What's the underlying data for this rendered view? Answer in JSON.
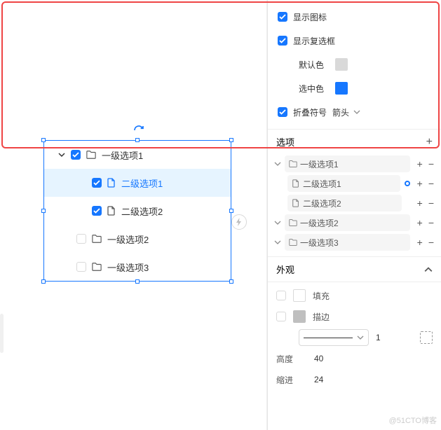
{
  "props": {
    "show_icon": "显示图标",
    "show_checkbox": "显示复选框",
    "default_color": "默认色",
    "selected_color": "选中色",
    "collapse_symbol": "折叠符号",
    "collapse_value": "箭头",
    "default_color_val": "#d9d9d9",
    "selected_color_val": "#1677ff"
  },
  "options": {
    "title": "选项",
    "items": [
      {
        "label": "一级选项1",
        "expand": true,
        "children": [
          {
            "label": "二级选项1",
            "active": true
          },
          {
            "label": "二级选项2"
          }
        ]
      },
      {
        "label": "一级选项2",
        "expand": true
      },
      {
        "label": "一级选项3",
        "expand": true
      }
    ]
  },
  "appearance": {
    "title": "外观",
    "fill": "填充",
    "stroke": "描边",
    "stroke_width": "1",
    "height_label": "高度",
    "height_val": "40",
    "indent_label": "缩进",
    "indent_val": "24"
  },
  "canvas": {
    "items": [
      {
        "label": "一级选项1",
        "checked": true,
        "type": "folder",
        "expanded": true,
        "level": 0
      },
      {
        "label": "二级选项1",
        "checked": true,
        "type": "file",
        "level": 1,
        "selected": true
      },
      {
        "label": "二级选项2",
        "checked": true,
        "type": "file",
        "level": 1
      },
      {
        "label": "一级选项2",
        "checked": false,
        "type": "folder",
        "level": 0
      },
      {
        "label": "一级选项3",
        "checked": false,
        "type": "folder",
        "level": 0
      }
    ]
  },
  "watermark": "@51CTO博客"
}
